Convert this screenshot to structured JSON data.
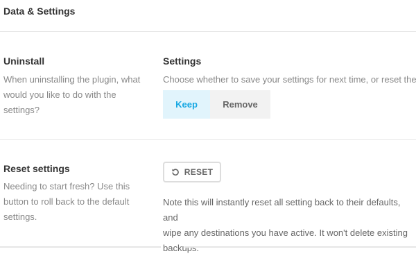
{
  "header": {
    "title": "Data & Settings"
  },
  "uninstall": {
    "title": "Uninstall",
    "description_lines": [
      "When uninstalling the plugin, what",
      "would you like to do with the",
      "settings?"
    ]
  },
  "settings": {
    "title": "Settings",
    "description": "Choose whether to save your settings for next time, or reset them.",
    "options": {
      "keep": "Keep",
      "remove": "Remove"
    },
    "selected": "Keep"
  },
  "reset": {
    "title": "Reset settings",
    "description_lines": [
      "Needing to start fresh? Use this",
      "button to roll back to the default",
      "settings."
    ],
    "button_label": "RESET",
    "button_icon": "undo-icon",
    "note_lines": [
      "Note this will instantly reset all setting back to their defaults, and",
      "wipe any destinations you have active. It won't delete existing",
      "backups."
    ]
  },
  "colors": {
    "accent": "#17a8e3",
    "accent_bg": "#e1f4fc",
    "text": "#333333",
    "muted": "#888888"
  }
}
